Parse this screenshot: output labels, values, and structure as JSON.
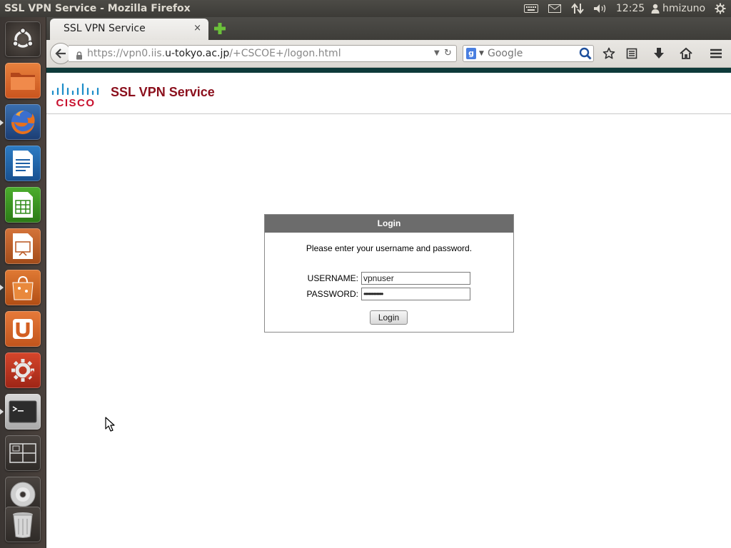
{
  "top_panel": {
    "window_title": "SSL VPN Service - Mozilla Firefox",
    "clock": "12:25",
    "user": "hmizuno",
    "indicators": [
      "keyboard-icon",
      "mail-icon",
      "network-icon",
      "volume-icon",
      "user-icon",
      "gear-icon"
    ]
  },
  "launcher": {
    "items": [
      {
        "name": "dash-home",
        "icon": "ubuntu-logo-icon"
      },
      {
        "name": "files",
        "icon": "folder-icon"
      },
      {
        "name": "firefox",
        "icon": "firefox-icon"
      },
      {
        "name": "libreoffice-writer",
        "icon": "writer-icon"
      },
      {
        "name": "libreoffice-calc",
        "icon": "calc-icon"
      },
      {
        "name": "libreoffice-impress",
        "icon": "impress-icon"
      },
      {
        "name": "software-center",
        "icon": "shopping-bag-icon"
      },
      {
        "name": "ubuntu-one",
        "icon": "ubuntu-one-icon"
      },
      {
        "name": "system-settings",
        "icon": "settings-icon"
      },
      {
        "name": "terminal",
        "icon": "terminal-icon"
      },
      {
        "name": "workspace-switcher",
        "icon": "workspace-icon"
      },
      {
        "name": "dvd",
        "icon": "disc-icon"
      },
      {
        "name": "trash",
        "icon": "trash-icon"
      }
    ]
  },
  "browser": {
    "tab_title": "SSL VPN Service",
    "tab_close": "×",
    "url_prefix": "https://vpn0.iis.",
    "url_domain": "u-tokyo.ac.jp",
    "url_suffix": "/+CSCOE+/logon.html",
    "search_placeholder": "Google"
  },
  "page": {
    "service_title": "SSL VPN Service",
    "login": {
      "header": "Login",
      "instruction": "Please enter your username and password.",
      "username_label": "USERNAME:",
      "username_value": "vpnuser",
      "password_label": "PASSWORD:",
      "password_value": "••••••••••••",
      "button_label": "Login"
    }
  },
  "colors": {
    "accent": "#0e3a3a",
    "service_title": "#8b0f1c",
    "login_header": "#6c6c6c",
    "cisco_blue": "#1b8cc8",
    "cisco_text": "#c8102e"
  }
}
